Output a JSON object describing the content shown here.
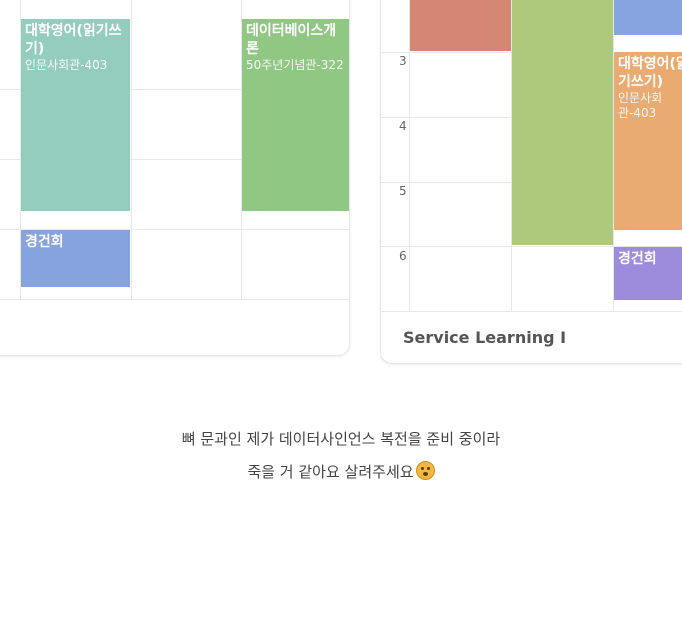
{
  "left_timetable": {
    "courses": [
      {
        "title": "대학영어(읽기쓰기)",
        "room": "인문사회관-403",
        "color": "#94ccbd"
      },
      {
        "title": "데이터베이스개론",
        "room": "50주년기념관-322",
        "color": "#8fc783"
      },
      {
        "title": "경건회",
        "room": "",
        "color": "#86a3e0"
      }
    ]
  },
  "right_timetable": {
    "hours": [
      "3",
      "4",
      "5",
      "6"
    ],
    "courses": [
      {
        "title": "",
        "room": "",
        "color": "#d48773"
      },
      {
        "title": "",
        "room": "",
        "color": "#aec97c"
      },
      {
        "title": "",
        "room": "",
        "color": "#87a4e0"
      },
      {
        "title": "대학영어(읽기쓰기)",
        "room": "인문사회관-403",
        "color": "#e9ab72"
      },
      {
        "title": "경건회",
        "room": "",
        "color": "#9d8cdc"
      }
    ],
    "footer": "Service Learning I"
  },
  "caption": {
    "line1": "뼈 문과인 제가 데이터사인언스 복전을 준비 중이라",
    "line2": "죽을 거 같아요 살려주세요",
    "emoji": "flushed-face"
  }
}
